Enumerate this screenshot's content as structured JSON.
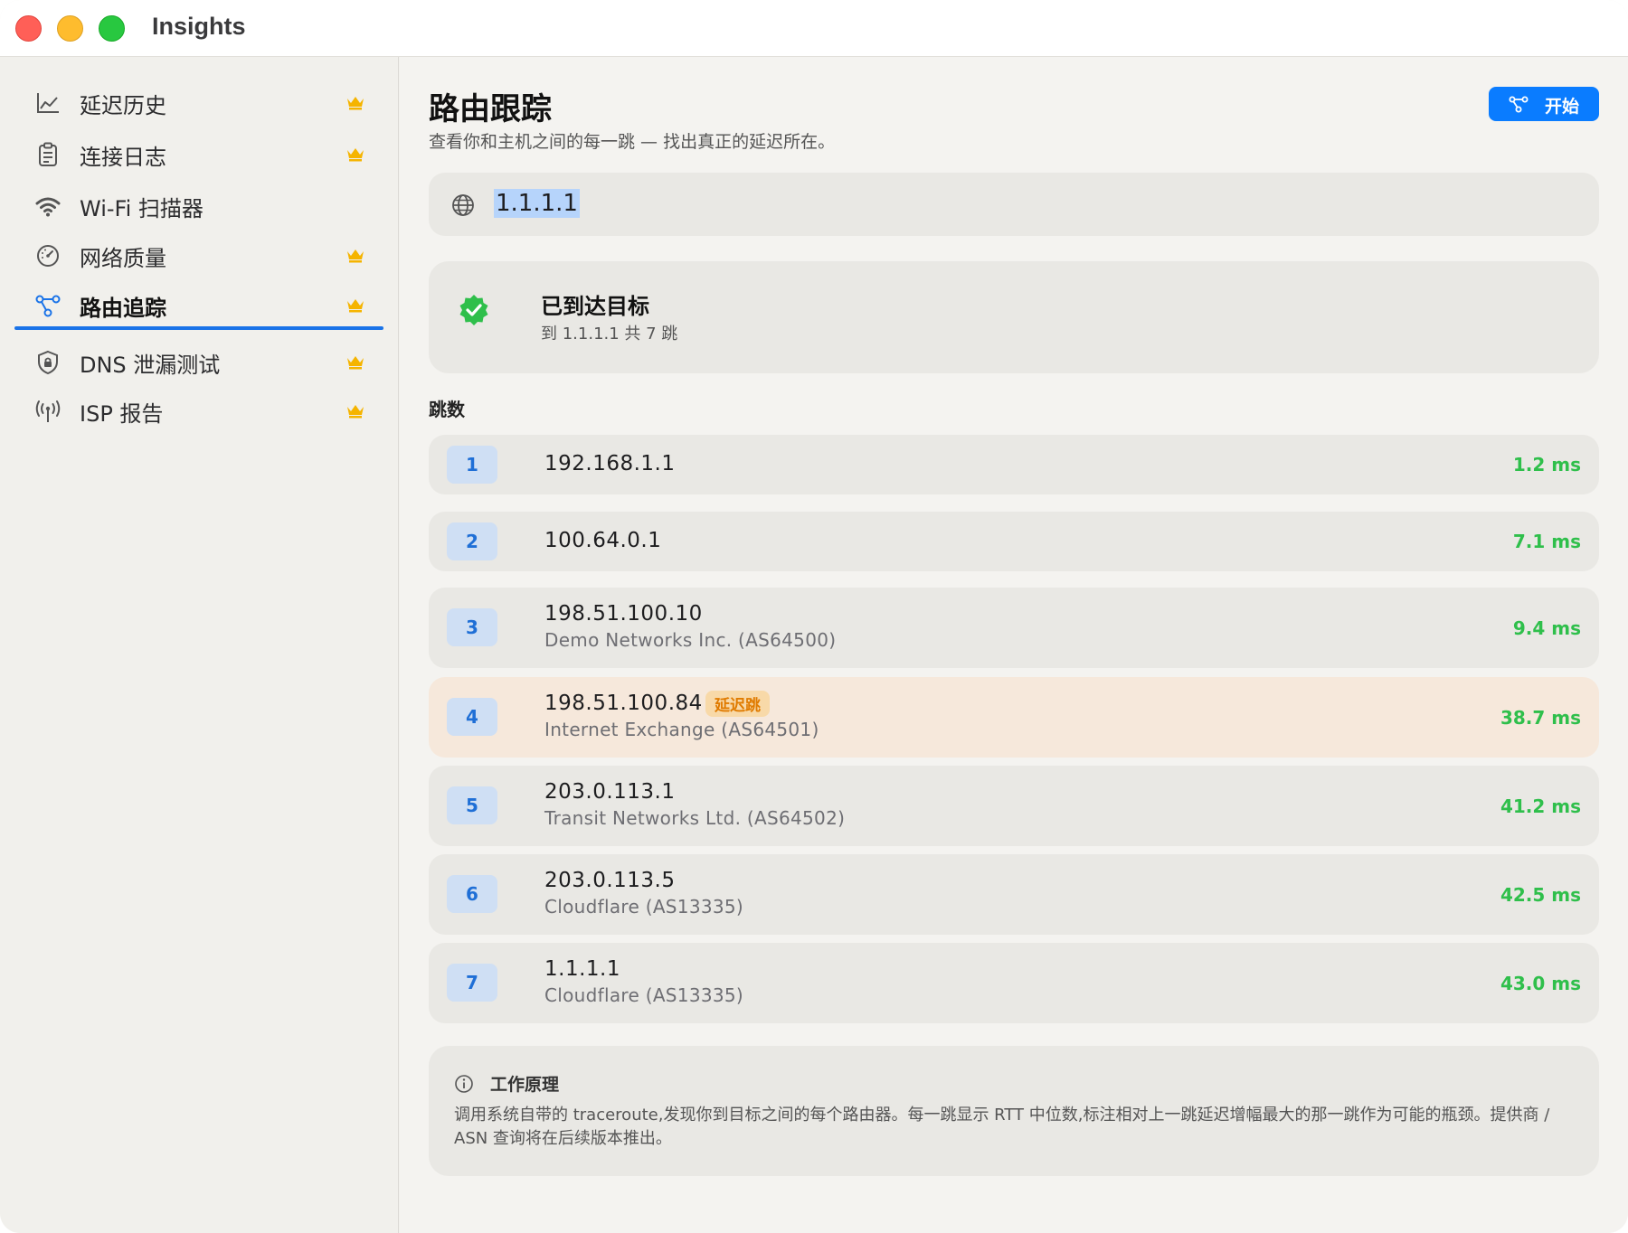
{
  "window": {
    "title": "Insights"
  },
  "sidebar": {
    "items": [
      {
        "label": "延迟历史",
        "icon": "chart-line-icon",
        "premium": true
      },
      {
        "label": "连接日志",
        "icon": "clipboard-icon",
        "premium": true
      },
      {
        "label": "Wi-Fi 扫描器",
        "icon": "wifi-icon",
        "premium": false
      },
      {
        "label": "网络质量",
        "icon": "gauge-icon",
        "premium": true
      },
      {
        "label": "路由追踪",
        "icon": "route-icon",
        "premium": true,
        "active": true
      },
      {
        "label": "DNS 泄漏测试",
        "icon": "shield-lock-icon",
        "premium": true
      },
      {
        "label": "ISP 报告",
        "icon": "antenna-icon",
        "premium": true
      }
    ]
  },
  "main": {
    "title": "路由跟踪",
    "subtitle": "查看你和主机之间的每一跳 — 找出真正的延迟所在。",
    "start_button": "开始",
    "target_value": "1.1.1.1",
    "status": {
      "title": "已到达目标",
      "detail": "到 1.1.1.1 共 7 跳"
    },
    "hops_label": "跳数",
    "hops": [
      {
        "n": "1",
        "ip": "192.168.1.1",
        "asn": "",
        "rtt": "1.2 ms",
        "flag": ""
      },
      {
        "n": "2",
        "ip": "100.64.0.1",
        "asn": "",
        "rtt": "7.1 ms",
        "flag": ""
      },
      {
        "n": "3",
        "ip": "198.51.100.10",
        "asn": "Demo Networks Inc. (AS64500)",
        "rtt": "9.4 ms",
        "flag": ""
      },
      {
        "n": "4",
        "ip": "198.51.100.84",
        "asn": "Internet Exchange (AS64501)",
        "rtt": "38.7 ms",
        "flag": "延迟跳"
      },
      {
        "n": "5",
        "ip": "203.0.113.1",
        "asn": "Transit Networks Ltd. (AS64502)",
        "rtt": "41.2 ms",
        "flag": ""
      },
      {
        "n": "6",
        "ip": "203.0.113.5",
        "asn": "Cloudflare (AS13335)",
        "rtt": "42.5 ms",
        "flag": ""
      },
      {
        "n": "7",
        "ip": "1.1.1.1",
        "asn": "Cloudflare (AS13335)",
        "rtt": "43.0 ms",
        "flag": ""
      }
    ],
    "info": {
      "title": "工作原理",
      "body": "调用系统自带的 traceroute,发现你到目标之间的每个路由器。每一跳显示 RTT 中位数,标注相对上一跳延迟增幅最大的那一跳作为可能的瓶颈。提供商 / ASN 查询将在后续版本推出。"
    }
  },
  "colors": {
    "accent": "#0a7cff",
    "latency_good": "#2fbf4b",
    "flag_bg": "#f6e8db",
    "flag_text": "#e07b00",
    "premium_crown": "#f5b400"
  }
}
